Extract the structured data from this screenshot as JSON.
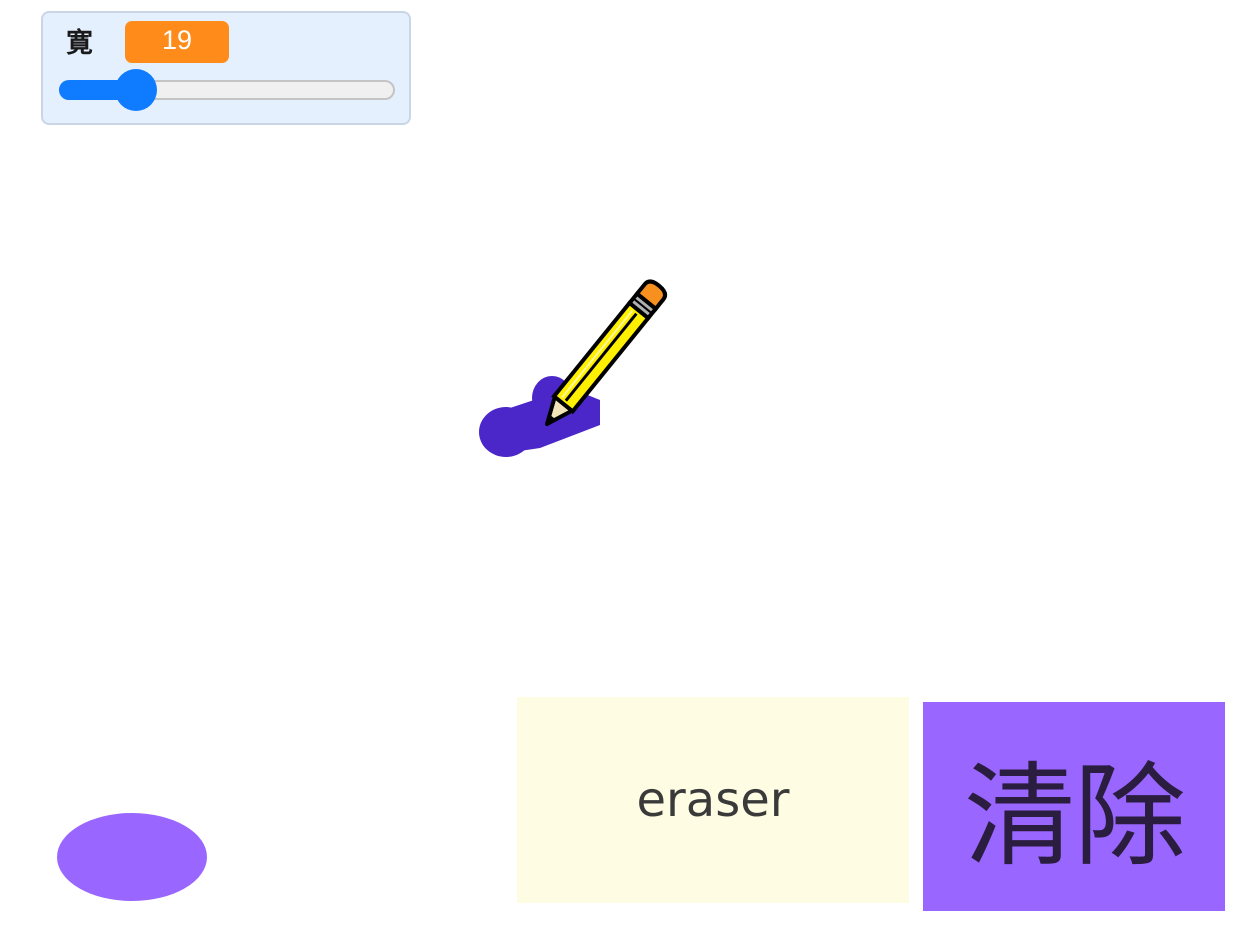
{
  "monitor": {
    "label": "寛",
    "value": "19",
    "slider": {
      "min": 0,
      "max": 100,
      "value": 19
    },
    "accent": "#0f7bff",
    "value_bg": "#ff8c1a"
  },
  "canvas": {
    "stroke_color": "#4b26c8",
    "pencil_color": "#ffef00",
    "eraser_tip_color": "#f7901e"
  },
  "buttons": {
    "eraser_label": "eraser",
    "clear_label": "清除",
    "eraser_bg": "#fefde4",
    "clear_bg": "#9966ff"
  },
  "color_swatch": {
    "color": "#9966ff"
  }
}
